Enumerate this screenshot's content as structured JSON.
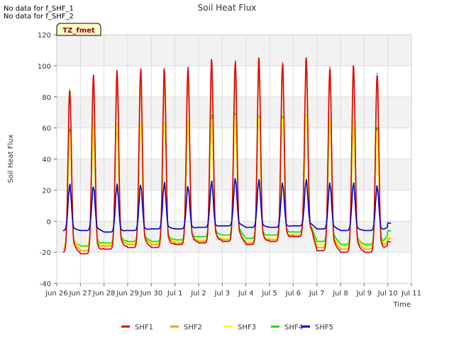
{
  "notes": [
    "No data for f_SHF_1",
    "No data for f_SHF_2"
  ],
  "chart_data": {
    "type": "line",
    "title": "Soil Heat Flux",
    "xlabel": "Time",
    "ylabel": "Soil Heat Flux",
    "site_label": "TZ_fmet",
    "xlim": [
      "2024-06-26",
      "2024-07-11"
    ],
    "ylim": [
      -40,
      120
    ],
    "x_ticks": [
      "Jun 26",
      "Jun 27",
      "Jun 28",
      "Jun 29",
      "Jun 30",
      "Jul 1",
      "Jul 2",
      "Jul 3",
      "Jul 4",
      "Jul 5",
      "Jul 6",
      "Jul 7",
      "Jul 8",
      "Jul 9",
      "Jul 10",
      "Jul 11"
    ],
    "y_ticks": [
      -40,
      -20,
      0,
      20,
      40,
      60,
      80,
      100,
      120
    ],
    "grid": true,
    "legend_position": "bottom",
    "x": [
      "Jun 26",
      "Jun 27",
      "Jun 28",
      "Jun 29",
      "Jun 30",
      "Jul 1",
      "Jul 2",
      "Jul 3",
      "Jul 4",
      "Jul 5",
      "Jul 6",
      "Jul 7",
      "Jul 8",
      "Jul 9",
      "Jul 10"
    ],
    "series": [
      {
        "name": "SHF1",
        "color": "#e00000",
        "daily_peak": [
          84,
          94,
          97,
          98,
          98,
          99,
          104,
          103,
          105,
          102,
          105,
          99,
          100,
          95,
          0
        ],
        "daily_min": [
          -20,
          -21,
          -18,
          -17,
          -17,
          -15,
          -14,
          -13,
          -15,
          -13,
          -10,
          -19,
          -20,
          -20,
          -16
        ]
      },
      {
        "name": "SHF2",
        "color": "#f0a000",
        "daily_peak": [
          85,
          85,
          87,
          89,
          88,
          90,
          94,
          94,
          96,
          95,
          97,
          93,
          95,
          90,
          0
        ],
        "daily_min": [
          -18,
          -19,
          -16,
          -15,
          -15,
          -14,
          -13,
          -12,
          -14,
          -12,
          -9,
          -17,
          -18,
          -18,
          -14
        ]
      },
      {
        "name": "SHF3",
        "color": "#ffff00",
        "daily_peak": [
          57,
          62,
          63,
          63,
          64,
          65,
          67,
          68,
          68,
          66,
          69,
          66,
          65,
          58,
          0
        ],
        "daily_min": [
          -16,
          -17,
          -15,
          -14,
          -14,
          -13,
          -12,
          -11,
          -13,
          -11,
          -9,
          -15,
          -16,
          -16,
          -13
        ]
      },
      {
        "name": "SHF4",
        "color": "#00e000",
        "daily_peak": [
          59,
          60,
          62,
          62,
          63,
          64,
          68,
          69,
          68,
          67,
          69,
          65,
          64,
          60,
          0
        ],
        "daily_min": [
          -16,
          -16,
          -14,
          -13,
          -13,
          -12,
          -10,
          -9,
          -11,
          -9,
          -7,
          -13,
          -15,
          -15,
          -9
        ]
      },
      {
        "name": "SHF5",
        "color": "#0000cc",
        "daily_peak": [
          23,
          22,
          23,
          23,
          24,
          22,
          25,
          27,
          26,
          24,
          26,
          24,
          24,
          22,
          0
        ],
        "daily_min": [
          -6,
          -6,
          -7,
          -6,
          -5,
          -5,
          -4,
          -3,
          -4,
          -4,
          -3,
          -5,
          -6,
          -6,
          -4
        ]
      }
    ]
  }
}
